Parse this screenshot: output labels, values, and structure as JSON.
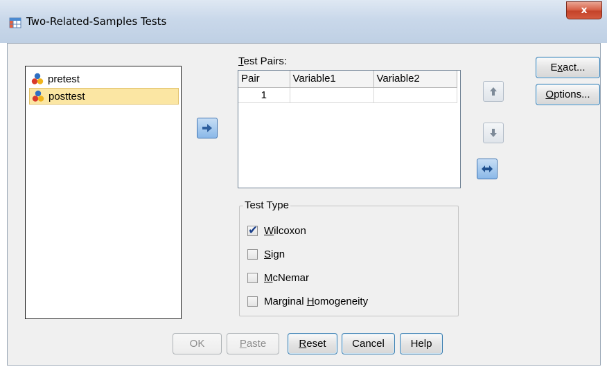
{
  "window": {
    "title": "Two-Related-Samples Tests",
    "close_label": "x"
  },
  "variables": [
    {
      "name": "pretest",
      "selected": false
    },
    {
      "name": "posttest",
      "selected": true
    }
  ],
  "test_pairs": {
    "label_first": "T",
    "label_rest": "est Pairs:",
    "columns": [
      "Pair",
      "Variable1",
      "Variable2"
    ],
    "rows": [
      {
        "pair": "1",
        "variable1": "",
        "variable2": ""
      }
    ]
  },
  "test_type": {
    "title": "Test Type",
    "options": [
      {
        "pre": "",
        "key": "W",
        "post": "ilcoxon",
        "checked": true
      },
      {
        "pre": "",
        "key": "S",
        "post": "ign",
        "checked": false
      },
      {
        "pre": "",
        "key": "M",
        "post": "cNemar",
        "checked": false
      },
      {
        "pre": "Marginal ",
        "key": "H",
        "post": "omogeneity",
        "checked": false
      }
    ]
  },
  "side_buttons": {
    "exact": {
      "pre": "E",
      "key": "x",
      "post": "act..."
    },
    "options": {
      "pre": "",
      "key": "O",
      "post": "ptions..."
    }
  },
  "bottom_buttons": {
    "ok": "OK",
    "paste": {
      "key": "P",
      "post": "aste"
    },
    "reset": {
      "key": "R",
      "post": "eset"
    },
    "cancel": "Cancel",
    "help": "Help"
  },
  "icons": {
    "title": "dialog-table-icon",
    "variable": "nominal-variable-icon",
    "move_right": "arrow-right-icon",
    "move_up": "arrow-up-icon",
    "move_down": "arrow-down-icon",
    "swap": "swap-horizontal-icon"
  },
  "colors": {
    "selection": "#fbe6a3",
    "button_border": "#3c7fb1",
    "arrow_blue": "#8ab8e8"
  }
}
